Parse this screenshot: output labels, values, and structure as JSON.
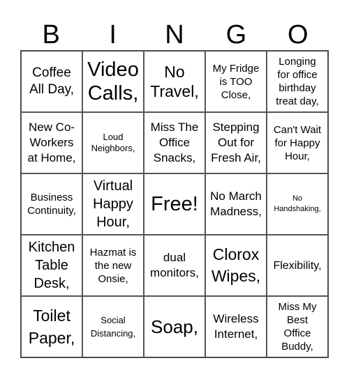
{
  "header": {
    "letters": [
      "B",
      "I",
      "N",
      "G",
      "O"
    ]
  },
  "grid": {
    "rows": [
      [
        "Coffee All Day,",
        "Video Calls,",
        "No Travel,",
        "My Fridge is TOO Close,",
        "Longing for office birthday treat day,"
      ],
      [
        "New Co-Workers at Home,",
        "Loud Neighbors,",
        "Miss The Office Snacks,",
        "Stepping Out for Fresh Air,",
        "Can't Wait for Happy Hour,"
      ],
      [
        "Business Continuity,",
        "Virtual Happy Hour,",
        "Free!",
        "No March Madness,",
        "No Handshaking,"
      ],
      [
        "Kitchen Table Desk,",
        "Hazmat is the new Onsie,",
        "dual monitors,",
        "Clorox Wipes,",
        "Flexibility,"
      ],
      [
        "Toilet Paper,",
        "Social Distancing,",
        "Soap,",
        "Wireless Internet,",
        "Miss My Best Office Buddy,"
      ]
    ]
  }
}
